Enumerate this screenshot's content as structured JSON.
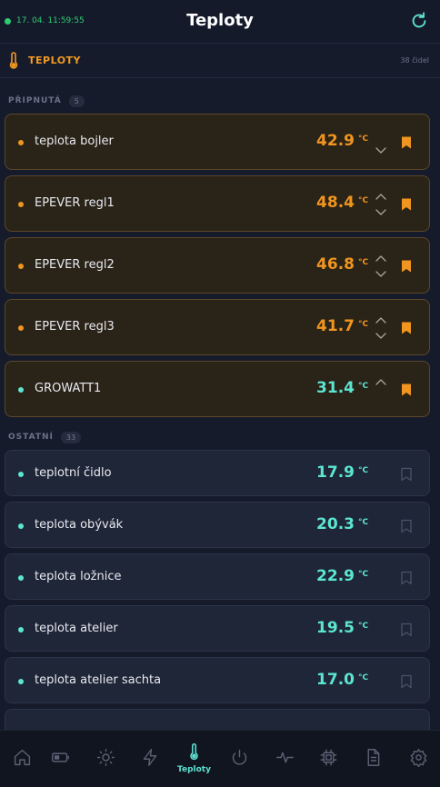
{
  "header": {
    "timestamp": "17. 04. 11:59:55",
    "title": "Teploty"
  },
  "section": {
    "label": "TEPLOTY",
    "count": "38 čidel"
  },
  "pinned": {
    "label": "PŘIPNUTÁ",
    "count": "5",
    "items": [
      {
        "name": "teplota bojler",
        "value": "42.9",
        "unit": "°C",
        "color": "#f0951f"
      },
      {
        "name": "EPEVER regl1",
        "value": "48.4",
        "unit": "°C",
        "color": "#f0951f"
      },
      {
        "name": "EPEVER regl2",
        "value": "46.8",
        "unit": "°C",
        "color": "#f0951f"
      },
      {
        "name": "EPEVER regl3",
        "value": "41.7",
        "unit": "°C",
        "color": "#f0951f"
      },
      {
        "name": "GROWATT1",
        "value": "31.4",
        "unit": "°C",
        "color": "#5ce6d2"
      }
    ]
  },
  "others": {
    "label": "OSTATNÍ",
    "count": "33",
    "items": [
      {
        "name": "teplotní čidlo",
        "value": "17.9",
        "unit": "°C"
      },
      {
        "name": "teplota obývák",
        "value": "20.3",
        "unit": "°C"
      },
      {
        "name": "teplota ložnice",
        "value": "22.9",
        "unit": "°C"
      },
      {
        "name": "teplota atelier",
        "value": "19.5",
        "unit": "°C"
      },
      {
        "name": "teplota atelier sachta",
        "value": "17.0",
        "unit": "°C"
      }
    ]
  },
  "nav": {
    "active_label": "Teploty"
  },
  "colors": {
    "accent_orange": "#f0951f",
    "accent_teal": "#5ce6d2",
    "online_green": "#2ecc71"
  }
}
